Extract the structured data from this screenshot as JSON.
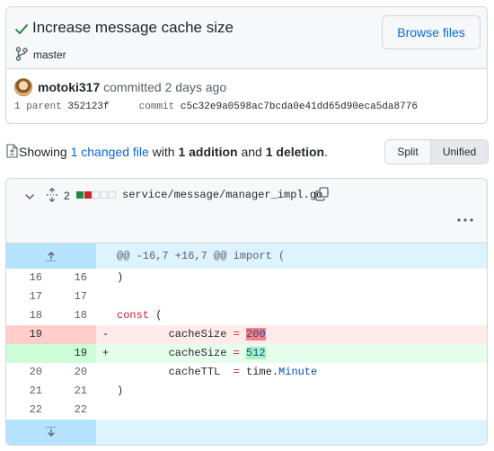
{
  "commit": {
    "title": "Increase message cache size",
    "branch": "master",
    "browse_label": "Browse files",
    "author": "motoki317",
    "action": "committed",
    "time": "2 days ago",
    "parent_label": "1 parent",
    "parent_sha": "352123f",
    "commit_label": "commit",
    "commit_sha": "c5c32e9a0598ac7bcda0e41dd65d90eca5da8776"
  },
  "summary": {
    "showing": "Showing",
    "changed": "1 changed file",
    "with": "with",
    "additions": "1 addition",
    "and": "and",
    "deletions": "1 deletion",
    "period": "."
  },
  "view_toggle": {
    "split": "Split",
    "unified": "Unified",
    "selected": "Unified"
  },
  "file": {
    "changes": "2",
    "path": "service/message/manager_impl.go",
    "stat_blocks": [
      "add",
      "del",
      "neutral",
      "neutral",
      "neutral"
    ]
  },
  "diff": {
    "hunk_header": "@@ -16,7 +16,7 @@ import (",
    "lines": [
      {
        "type": "ctx",
        "old": "16",
        "new": "16",
        "marker": "",
        "code": ")"
      },
      {
        "type": "ctx",
        "old": "17",
        "new": "17",
        "marker": "",
        "code": ""
      },
      {
        "type": "ctx",
        "old": "18",
        "new": "18",
        "marker": "",
        "code": "const ("
      },
      {
        "type": "del",
        "old": "19",
        "new": "",
        "marker": "-",
        "code": "        cacheSize = 200"
      },
      {
        "type": "add",
        "old": "",
        "new": "19",
        "marker": "+",
        "code": "        cacheSize = 512"
      },
      {
        "type": "ctx",
        "old": "20",
        "new": "20",
        "marker": "",
        "code": "        cacheTTL  = time.Minute"
      },
      {
        "type": "ctx",
        "old": "21",
        "new": "21",
        "marker": "",
        "code": ")"
      },
      {
        "type": "ctx",
        "old": "22",
        "new": "22",
        "marker": "",
        "code": ""
      }
    ]
  },
  "colors": {
    "accent": "#0969da",
    "addition": "#1f883d",
    "deletion": "#cf222e",
    "hunk_bg": "#ddf4ff"
  },
  "icons": {
    "check": "check-icon",
    "branch": "git-branch-icon",
    "file": "file-diff-icon",
    "chevron": "chevron-down-icon",
    "unfold": "unfold-icon",
    "copy": "copy-icon",
    "kebab": "kebab-horizontal-icon",
    "expand_up": "expand-up-icon",
    "expand_down": "expand-down-icon"
  }
}
